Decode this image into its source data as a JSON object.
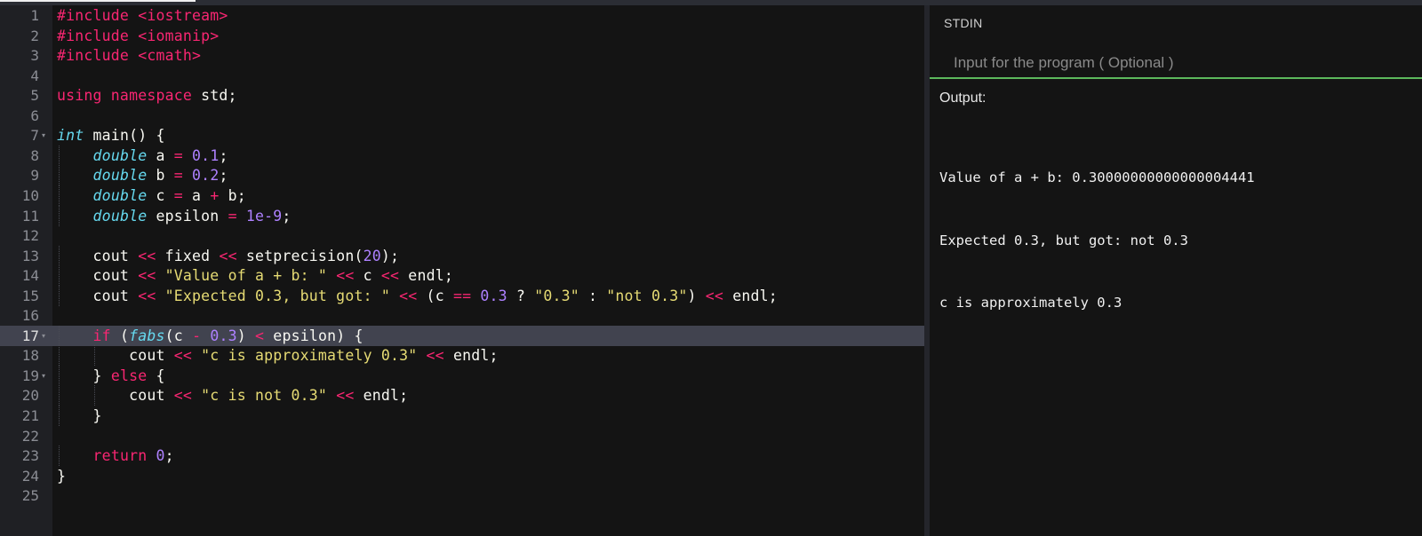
{
  "editor": {
    "active_line": 17,
    "lines": [
      {
        "n": "1",
        "tokens": [
          {
            "t": "#include <iostream>",
            "c": "k-pre"
          }
        ]
      },
      {
        "n": "2",
        "tokens": [
          {
            "t": "#include <iomanip>",
            "c": "k-pre"
          }
        ]
      },
      {
        "n": "3",
        "tokens": [
          {
            "t": "#include <cmath>",
            "c": "k-pre"
          }
        ]
      },
      {
        "n": "4",
        "tokens": []
      },
      {
        "n": "5",
        "tokens": [
          {
            "t": "using namespace",
            "c": "k-kw"
          },
          {
            "t": " std;",
            "c": ""
          }
        ]
      },
      {
        "n": "6",
        "tokens": []
      },
      {
        "n": "7",
        "fold": true,
        "tokens": [
          {
            "t": "int",
            "c": "k-type"
          },
          {
            "t": " main() {",
            "c": ""
          }
        ]
      },
      {
        "n": "8",
        "indent": 1,
        "tokens": [
          {
            "t": "    ",
            "c": ""
          },
          {
            "t": "double",
            "c": "k-type"
          },
          {
            "t": " a ",
            "c": ""
          },
          {
            "t": "=",
            "c": "k-op"
          },
          {
            "t": " ",
            "c": ""
          },
          {
            "t": "0.1",
            "c": "k-num"
          },
          {
            "t": ";",
            "c": ""
          }
        ]
      },
      {
        "n": "9",
        "indent": 1,
        "tokens": [
          {
            "t": "    ",
            "c": ""
          },
          {
            "t": "double",
            "c": "k-type"
          },
          {
            "t": " b ",
            "c": ""
          },
          {
            "t": "=",
            "c": "k-op"
          },
          {
            "t": " ",
            "c": ""
          },
          {
            "t": "0.2",
            "c": "k-num"
          },
          {
            "t": ";",
            "c": ""
          }
        ]
      },
      {
        "n": "10",
        "indent": 1,
        "tokens": [
          {
            "t": "    ",
            "c": ""
          },
          {
            "t": "double",
            "c": "k-type"
          },
          {
            "t": " c ",
            "c": ""
          },
          {
            "t": "=",
            "c": "k-op"
          },
          {
            "t": " a ",
            "c": ""
          },
          {
            "t": "+",
            "c": "k-op"
          },
          {
            "t": " b;",
            "c": ""
          }
        ]
      },
      {
        "n": "11",
        "indent": 1,
        "tokens": [
          {
            "t": "    ",
            "c": ""
          },
          {
            "t": "double",
            "c": "k-type"
          },
          {
            "t": " epsilon ",
            "c": ""
          },
          {
            "t": "=",
            "c": "k-op"
          },
          {
            "t": " ",
            "c": ""
          },
          {
            "t": "1e-9",
            "c": "k-num"
          },
          {
            "t": ";",
            "c": ""
          }
        ]
      },
      {
        "n": "12",
        "tokens": []
      },
      {
        "n": "13",
        "indent": 1,
        "tokens": [
          {
            "t": "    cout ",
            "c": ""
          },
          {
            "t": "<<",
            "c": "k-op"
          },
          {
            "t": " fixed ",
            "c": ""
          },
          {
            "t": "<<",
            "c": "k-op"
          },
          {
            "t": " setprecision(",
            "c": ""
          },
          {
            "t": "20",
            "c": "k-num"
          },
          {
            "t": ");",
            "c": ""
          }
        ]
      },
      {
        "n": "14",
        "indent": 1,
        "tokens": [
          {
            "t": "    cout ",
            "c": ""
          },
          {
            "t": "<<",
            "c": "k-op"
          },
          {
            "t": " ",
            "c": ""
          },
          {
            "t": "\"Value of a + b: \"",
            "c": "k-str"
          },
          {
            "t": " ",
            "c": ""
          },
          {
            "t": "<<",
            "c": "k-op"
          },
          {
            "t": " c ",
            "c": ""
          },
          {
            "t": "<<",
            "c": "k-op"
          },
          {
            "t": " endl;",
            "c": ""
          }
        ]
      },
      {
        "n": "15",
        "indent": 1,
        "tokens": [
          {
            "t": "    cout ",
            "c": ""
          },
          {
            "t": "<<",
            "c": "k-op"
          },
          {
            "t": " ",
            "c": ""
          },
          {
            "t": "\"Expected 0.3, but got: \"",
            "c": "k-str"
          },
          {
            "t": " ",
            "c": ""
          },
          {
            "t": "<<",
            "c": "k-op"
          },
          {
            "t": " (c ",
            "c": ""
          },
          {
            "t": "==",
            "c": "k-op"
          },
          {
            "t": " ",
            "c": ""
          },
          {
            "t": "0.3",
            "c": "k-num"
          },
          {
            "t": " ? ",
            "c": ""
          },
          {
            "t": "\"0.3\"",
            "c": "k-str"
          },
          {
            "t": " : ",
            "c": ""
          },
          {
            "t": "\"not 0.3\"",
            "c": "k-str"
          },
          {
            "t": ") ",
            "c": ""
          },
          {
            "t": "<<",
            "c": "k-op"
          },
          {
            "t": " endl;",
            "c": ""
          }
        ]
      },
      {
        "n": "16",
        "tokens": []
      },
      {
        "n": "17",
        "fold": true,
        "indent": 1,
        "tokens": [
          {
            "t": "    ",
            "c": ""
          },
          {
            "t": "if",
            "c": "k-kw"
          },
          {
            "t": " (",
            "c": ""
          },
          {
            "t": "fabs",
            "c": "k-type"
          },
          {
            "t": "(c ",
            "c": ""
          },
          {
            "t": "-",
            "c": "k-op"
          },
          {
            "t": " ",
            "c": ""
          },
          {
            "t": "0.3",
            "c": "k-num"
          },
          {
            "t": ") ",
            "c": ""
          },
          {
            "t": "<",
            "c": "k-op"
          },
          {
            "t": " epsilon) {",
            "c": ""
          }
        ]
      },
      {
        "n": "18",
        "indent": 2,
        "tokens": [
          {
            "t": "        cout ",
            "c": ""
          },
          {
            "t": "<<",
            "c": "k-op"
          },
          {
            "t": " ",
            "c": ""
          },
          {
            "t": "\"c is approximately 0.3\"",
            "c": "k-str"
          },
          {
            "t": " ",
            "c": ""
          },
          {
            "t": "<<",
            "c": "k-op"
          },
          {
            "t": " endl;",
            "c": ""
          }
        ]
      },
      {
        "n": "19",
        "fold": true,
        "indent": 1,
        "tokens": [
          {
            "t": "    } ",
            "c": ""
          },
          {
            "t": "else",
            "c": "k-kw"
          },
          {
            "t": " {",
            "c": ""
          }
        ]
      },
      {
        "n": "20",
        "indent": 2,
        "tokens": [
          {
            "t": "        cout ",
            "c": ""
          },
          {
            "t": "<<",
            "c": "k-op"
          },
          {
            "t": " ",
            "c": ""
          },
          {
            "t": "\"c is not 0.3\"",
            "c": "k-str"
          },
          {
            "t": " ",
            "c": ""
          },
          {
            "t": "<<",
            "c": "k-op"
          },
          {
            "t": " endl;",
            "c": ""
          }
        ]
      },
      {
        "n": "21",
        "indent": 1,
        "tokens": [
          {
            "t": "    }",
            "c": ""
          }
        ]
      },
      {
        "n": "22",
        "tokens": []
      },
      {
        "n": "23",
        "indent": 1,
        "tokens": [
          {
            "t": "    ",
            "c": ""
          },
          {
            "t": "return",
            "c": "k-kw"
          },
          {
            "t": " ",
            "c": ""
          },
          {
            "t": "0",
            "c": "k-num"
          },
          {
            "t": ";",
            "c": ""
          }
        ]
      },
      {
        "n": "24",
        "tokens": [
          {
            "t": "}",
            "c": ""
          }
        ]
      },
      {
        "n": "25",
        "tokens": []
      }
    ]
  },
  "stdin": {
    "label": "STDIN",
    "placeholder": "Input for the program ( Optional )"
  },
  "output": {
    "label": "Output:",
    "lines": [
      "Value of a + b: 0.30000000000000004441",
      "Expected 0.3, but got: not 0.3",
      "c is approximately 0.3"
    ]
  }
}
